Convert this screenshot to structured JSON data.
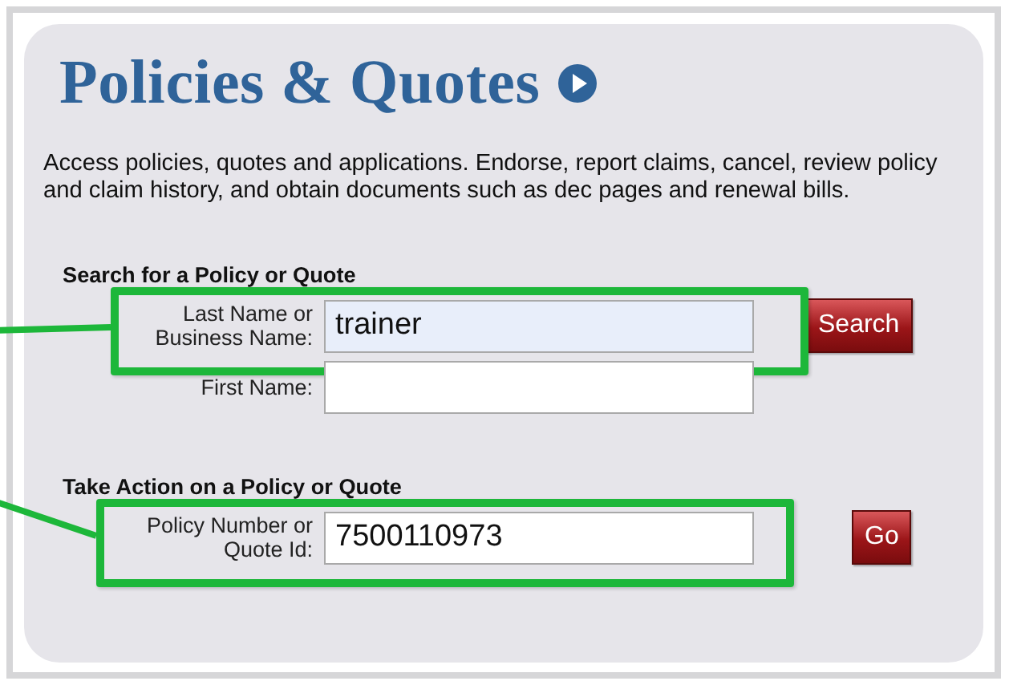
{
  "title": "Policies & Quotes",
  "description": "Access policies, quotes and applications.  Endorse, report claims, cancel, review policy and claim history, and obtain documents such as dec pages and renewal bills.",
  "sections": [
    {
      "heading": "Search for a Policy or Quote",
      "button": "Search",
      "fields": [
        {
          "label": "Last Name or\nBusiness Name:",
          "value": "trainer",
          "highlighted": true,
          "focused": true
        },
        {
          "label": "First Name:",
          "highlighted": false,
          "focused": false
        }
      ]
    },
    {
      "heading": "Take Action on a Policy or Quote",
      "button": "Go",
      "fields": [
        {
          "label": "Policy Number or\nQuote Id:",
          "value": "7500110973",
          "highlighted": true,
          "focused": false
        }
      ]
    }
  ]
}
